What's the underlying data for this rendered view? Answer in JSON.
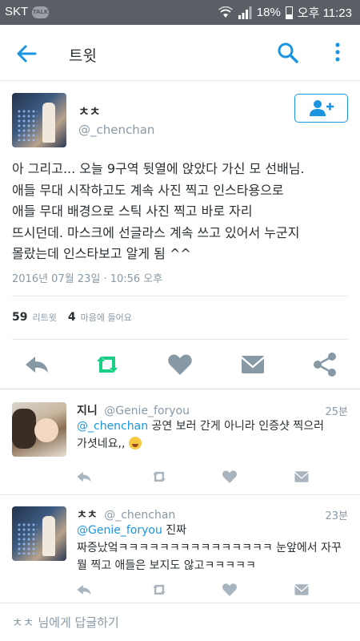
{
  "status_bar": {
    "carrier": "SKT",
    "talk_badge": "TALK",
    "battery": "18%",
    "time": "오후 11:23"
  },
  "app_bar": {
    "title": "트윗",
    "back_icon": "arrow-left-icon",
    "search_icon": "search-icon",
    "more_icon": "more-vertical-icon",
    "accent_color": "#1b95e0"
  },
  "tweet": {
    "display_name": "ㅊㅊ",
    "handle": "@_chenchan",
    "follow_icon": "follow-user-icon",
    "text_lines": [
      "아 그리고... 오늘 9구역 뒷열에 앉았다 가신 모 선배님.",
      "애들 무대 시작하고도 계속 사진 찍고 인스타용으로",
      "애들 무대 배경으로 스틱 사진 찍고 바로 자리",
      "뜨시던데. 마스크에 선글라스 계속 쓰고 있어서 누군지",
      "몰랐는데 인스타보고 알게 됨 ^^"
    ],
    "timestamp": "2016년 07월 23일 · 10:56 오후",
    "retweet_count": "59",
    "retweet_label": "리트윗",
    "like_count": "4",
    "like_label": "마음에 들어요",
    "actions": [
      "reply-icon",
      "retweet-icon",
      "heart-icon",
      "dm-icon",
      "share-icon"
    ],
    "retweet_active_color": "#19cf86"
  },
  "replies": [
    {
      "display_name": "지니",
      "handle": "@Genie_foryou",
      "time": "25분",
      "mention": "@_chenchan",
      "line1": " 공연 보러 간게 아니라 인증샷 찍으러",
      "line2": "가셧네요,,"
    },
    {
      "display_name": "ㅊㅊ",
      "handle": "@_chenchan",
      "time": "23분",
      "mention": "@Genie_foryou",
      "line1": " 진짜",
      "line2": "짜증났엌ㅋㅋㅋㅋㅋㅋㅋㅋㅋㅋㅋㅋㅋㅋㅋ 눈앞에서 자꾸",
      "line3": "뭘 찍고 애들은 보지도 않고ㅋㅋㅋㅋㅋ"
    }
  ],
  "reply_input": {
    "placeholder": "ㅊㅊ 님에게 답글하기"
  }
}
